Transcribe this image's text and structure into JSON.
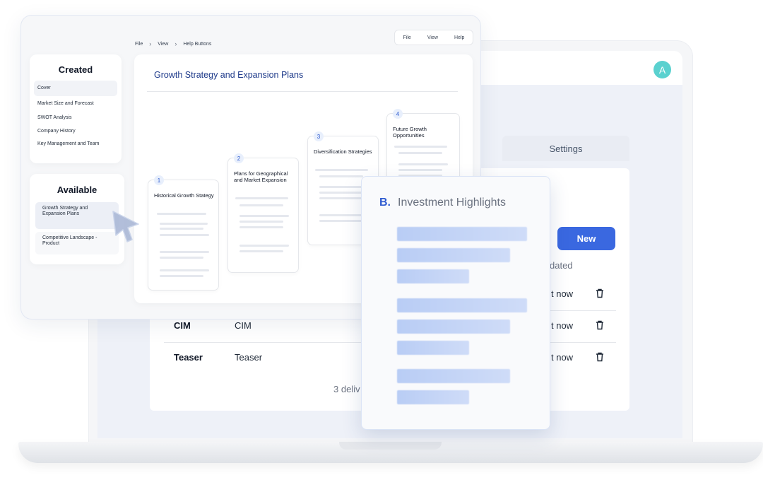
{
  "laptop": {
    "avatar_letter": "A",
    "settings_tab": "Settings",
    "new_button": "New",
    "updated_header_fragment": "dated",
    "rows": [
      {
        "name": "",
        "type": "",
        "time_fragment": "t now"
      },
      {
        "name": "CIM",
        "type": "CIM",
        "time_fragment": "t now"
      },
      {
        "name": "Teaser",
        "type": "Teaser",
        "time_fragment": "t now"
      }
    ],
    "footer_fragment": "3 deliv"
  },
  "app": {
    "breadcrumb": [
      "File",
      "View",
      "Help Buttons"
    ],
    "menu": [
      "File",
      "View",
      "Help"
    ],
    "created": {
      "title": "Created",
      "items": [
        "Cover",
        "Market Size and Forecast",
        "SWOT Analysis",
        "Company History",
        "Key Management and Team"
      ]
    },
    "available": {
      "title": "Available",
      "items": [
        "Growth Strategy and Expansion Plans",
        "Competitive Landscape - Product"
      ]
    },
    "document": {
      "title": "Growth Strategy and Expansion Plans",
      "steps": [
        {
          "num": "1",
          "label": "Historical Growth Stategy"
        },
        {
          "num": "2",
          "label": "Plans for Geographical and Market Expansion"
        },
        {
          "num": "3",
          "label": "Diversification Strategies"
        },
        {
          "num": "4",
          "label": "Future Growth Opportunities"
        }
      ]
    }
  },
  "highlights": {
    "prefix": "B.",
    "title": "Investment Highlights"
  },
  "colors": {
    "accent": "#3a68e0",
    "avatar": "#5ad1cf",
    "title_blue": "#1e3a8a"
  }
}
